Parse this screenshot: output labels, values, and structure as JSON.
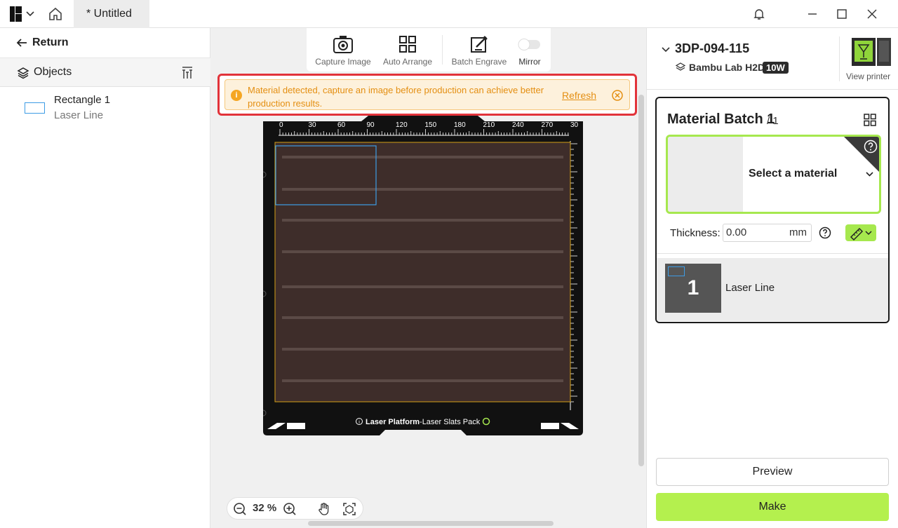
{
  "titlebar": {
    "tab_title": "* Untitled"
  },
  "left": {
    "return_label": "Return",
    "objects_label": "Objects",
    "items": [
      {
        "name": "Rectangle 1",
        "type": "Laser Line"
      }
    ]
  },
  "toolbar": {
    "capture_label": "Capture Image",
    "arrange_label": "Auto Arrange",
    "batch_label": "Batch Engrave",
    "mirror_label": "Mirror"
  },
  "alert": {
    "message": "Material detected, capture an image before production can achieve better production results.",
    "refresh_label": "Refresh"
  },
  "bed": {
    "ruler_ticks": [
      "0",
      "30",
      "60",
      "90",
      "120",
      "150",
      "180",
      "210",
      "240",
      "270",
      "30"
    ],
    "platform_bold": "Laser Platform",
    "platform_rest": "-Laser Slats Pack"
  },
  "zoom": {
    "value": "32 %"
  },
  "printer": {
    "name": "3DP-094-115",
    "model": "Bambu Lab H2D",
    "power_badge": "10W",
    "view_label": "View printer"
  },
  "batch": {
    "title": "Material Batch 1",
    "count": "/ 1",
    "select_material": "Select a material",
    "thickness_label": "Thickness:",
    "thickness_value": "0.00",
    "thickness_unit": "mm",
    "object_number": "1",
    "object_label": "Laser Line"
  },
  "actions": {
    "preview_label": "Preview",
    "make_label": "Make"
  },
  "colors": {
    "accent": "#b4f04e",
    "alert_text": "#e48f12",
    "alert_border": "#e2333a",
    "bed": "#3e2d2a"
  }
}
